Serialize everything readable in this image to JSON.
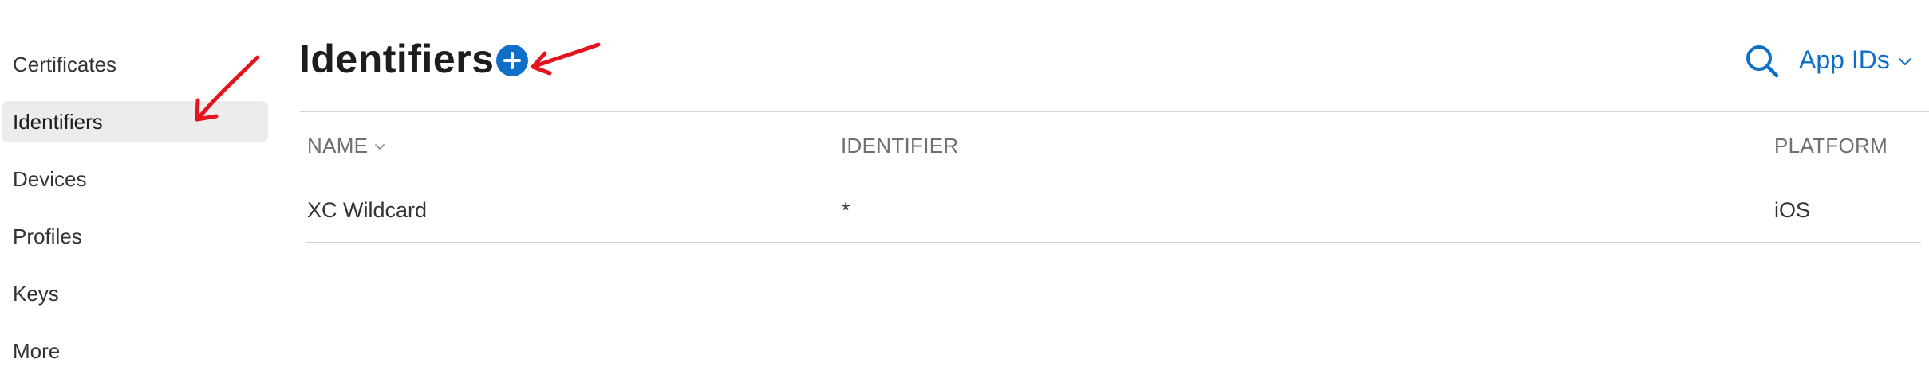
{
  "sidebar": {
    "items": [
      {
        "label": "Certificates",
        "active": false
      },
      {
        "label": "Identifiers",
        "active": true
      },
      {
        "label": "Devices",
        "active": false
      },
      {
        "label": "Profiles",
        "active": false
      },
      {
        "label": "Keys",
        "active": false
      },
      {
        "label": "More",
        "active": false
      }
    ]
  },
  "header": {
    "title": "Identifiers",
    "add_icon": "plus-circle-icon",
    "search_icon": "search-icon",
    "filter_label": "App IDs",
    "filter_icon": "chevron-down-icon"
  },
  "table": {
    "columns": [
      {
        "label": "NAME",
        "sortable": true
      },
      {
        "label": "IDENTIFIER",
        "sortable": false
      },
      {
        "label": "PLATFORM",
        "sortable": false
      }
    ],
    "rows": [
      {
        "name": "XC Wildcard",
        "identifier": "*",
        "platform": "iOS"
      }
    ]
  },
  "colors": {
    "accent": "#0f6fc6",
    "annotation": "#e3141e",
    "active_item_bg": "#ececec",
    "divider": "#d2d2d7"
  }
}
